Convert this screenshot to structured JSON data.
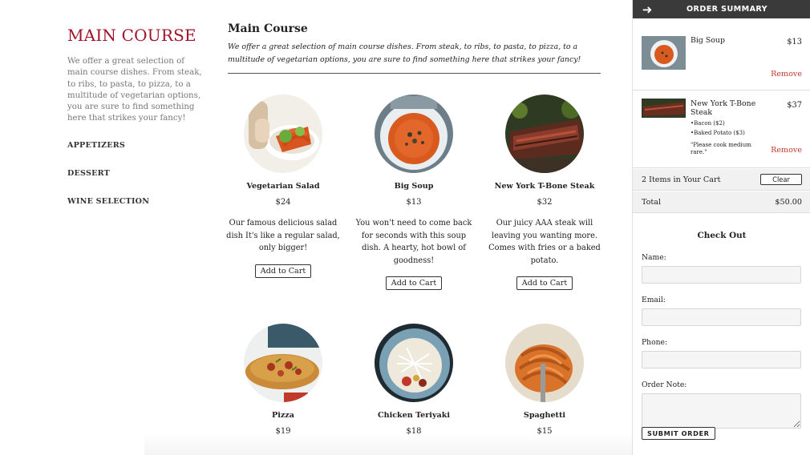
{
  "sidebar": {
    "title": "MAIN COURSE",
    "intro": "We offer a great selection of main course dishes. From steak, to ribs, to pasta, to pizza, to a multitude of vegetarian options, you are sure to find something here that strikes your fancy!",
    "nav": [
      "APPETIZERS",
      "DESSERT",
      "WINE SELECTION"
    ]
  },
  "main": {
    "heading": "Main Course",
    "lead": "We offer a great selection of main course dishes. From steak, to ribs, to pasta, to pizza, to a multitude of vegetarian options, you are sure to find something here that strikes your fancy!",
    "add_label": "Add to Cart",
    "dishes": [
      {
        "name": "Vegetarian Salad",
        "price": "$24",
        "desc": "Our famous delicious salad dish It's like a regular salad, only bigger!",
        "icon": "salad-photo"
      },
      {
        "name": "Big Soup",
        "price": "$13",
        "desc": "You won't need to come back for seconds with this soup dish. A hearty, hot bowl of goodness!",
        "icon": "soup-photo"
      },
      {
        "name": "New York T-Bone Steak",
        "price": "$32",
        "desc": "Our juicy AAA steak will leaving you wanting more. Comes with fries or a baked potato.",
        "icon": "steak-photo"
      },
      {
        "name": "Pizza",
        "price": "$19",
        "icon": "pizza-photo"
      },
      {
        "name": "Chicken Teriyaki",
        "price": "$18",
        "icon": "teriyaki-photo"
      },
      {
        "name": "Spaghetti",
        "price": "$15",
        "icon": "spaghetti-photo"
      }
    ]
  },
  "summary": {
    "title": "ORDER SUMMARY",
    "remove_label": "Remove",
    "items": [
      {
        "name": "Big Soup",
        "price": "$13"
      },
      {
        "name": "New York T-Bone Steak",
        "price": "$37",
        "options": [
          "Bacon ($2)",
          "Baked Potato ($3)"
        ],
        "note": "\"Please cook medium rare.\""
      }
    ],
    "cart_count": "2 Items in Your Cart",
    "clear_label": "Clear",
    "total_label": "Total",
    "total_value": "$50.00"
  },
  "checkout": {
    "title": "Check Out",
    "name_label": "Name:",
    "email_label": "Email:",
    "phone_label": "Phone:",
    "note_label": "Order Note:",
    "submit_label": "SUBMIT ORDER"
  },
  "colors": {
    "accent": "#a3122a",
    "remove": "#c0392b",
    "header": "#3a3a3a"
  }
}
